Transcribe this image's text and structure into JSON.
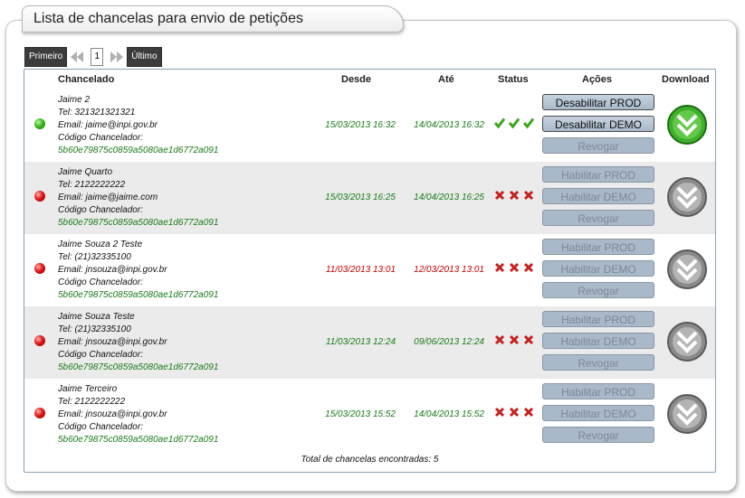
{
  "page": {
    "title": "Lista de chancelas para envio de petições"
  },
  "pager": {
    "first": "Primeiro",
    "current": "1",
    "last": "Último"
  },
  "table": {
    "headers": {
      "chancelado": "Chancelado",
      "desde": "Desde",
      "ate": "Até",
      "status": "Status",
      "acoes": "Ações",
      "download": "Download"
    },
    "code_label": "Código Chancelador:",
    "rows": [
      {
        "name": "Jaime 2",
        "tel": "Tel: 321321321321",
        "email": "Email: jaime@inpi.gov.br",
        "code": "5b60e79875c0859a5080ae1d6772a091",
        "desde": "15/03/2013 16:32",
        "ate": "14/04/2013 16:32",
        "b1": "Desabilitar PROD",
        "b2": "Desabilitar DEMO",
        "b3": "Revogar"
      },
      {
        "name": "Jaime Quarto",
        "tel": "Tel: 2122222222",
        "email": "Email: jaime@jaime.com",
        "code": "5b60e79875c0859a5080ae1d6772a091",
        "desde": "15/03/2013 16:25",
        "ate": "14/04/2013 16:25",
        "b1": "Habilitar PROD",
        "b2": "Habilitar DEMO",
        "b3": "Revogar"
      },
      {
        "name": "Jaime Souza 2 Teste",
        "tel": "Tel: (21)32335100",
        "email": "Email: jnsouza@inpi.gov.br",
        "code": "5b60e79875c0859a5080ae1d6772a091",
        "desde": "11/03/2013 13:01",
        "ate": "12/03/2013 13:01",
        "b1": "Habilitar PROD",
        "b2": "Habilitar DEMO",
        "b3": "Revogar"
      },
      {
        "name": "Jaime Souza Teste",
        "tel": "Tel: (21)32335100",
        "email": "Email: jnsouza@inpi.gov.br",
        "code": "5b60e79875c0859a5080ae1d6772a091",
        "desde": "11/03/2013 12:24",
        "ate": "09/06/2013 12:24",
        "b1": "Habilitar PROD",
        "b2": "Habilitar DEMO",
        "b3": "Revogar"
      },
      {
        "name": "Jaime Terceiro",
        "tel": "Tel: 2122222222",
        "email": "Email: jnsouza@inpi.gov.br",
        "code": "5b60e79875c0859a5080ae1d6772a091",
        "desde": "15/03/2013 15:52",
        "ate": "14/04/2013 15:52",
        "b1": "Habilitar PROD",
        "b2": "Habilitar DEMO",
        "b3": "Revogar"
      }
    ],
    "footer": "Total de chancelas encontradas: 5"
  },
  "colors": {
    "ok": "#1a7a1a",
    "bad": "#c40000",
    "button": "#a9b9ca",
    "grid_border": "#8aa1b5"
  },
  "icons": {
    "active": "green-dot-icon",
    "inactive": "red-dot-icon",
    "ok": "green-check-icon",
    "fail": "red-x-icon",
    "download": "download-chevron-icon"
  }
}
